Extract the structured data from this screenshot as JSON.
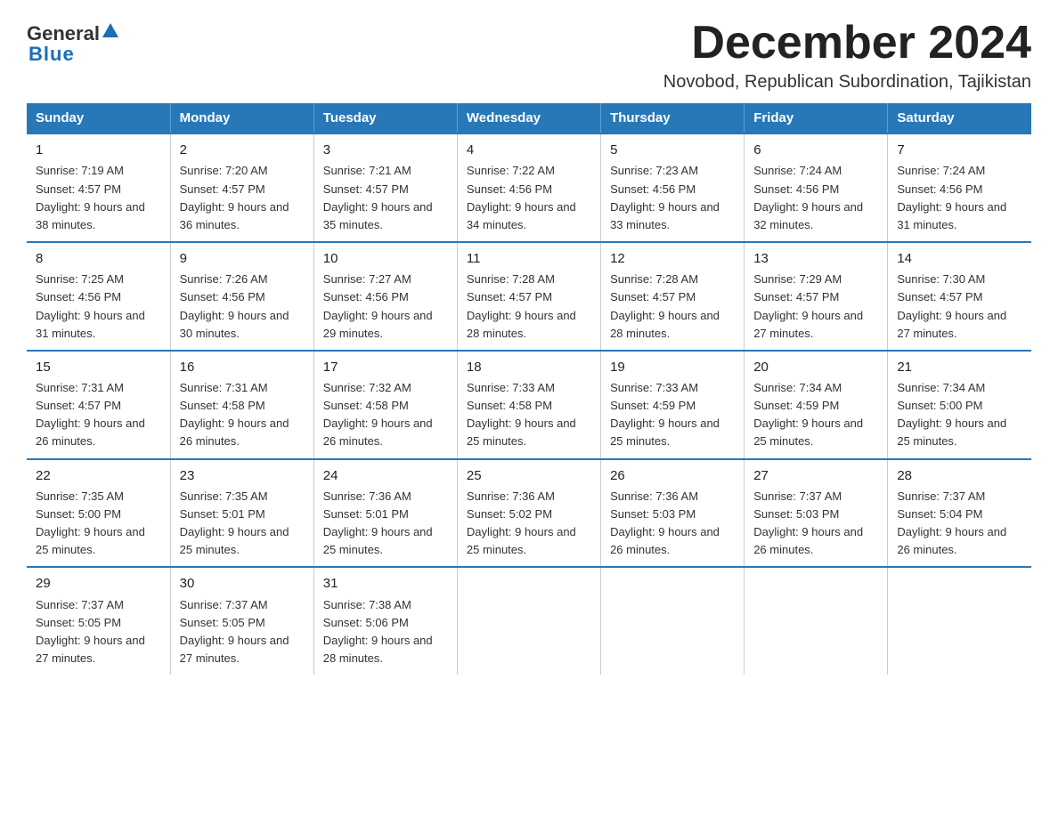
{
  "logo": {
    "general": "General",
    "blue": "Blue"
  },
  "title": "December 2024",
  "subtitle": "Novobod, Republican Subordination, Tajikistan",
  "weekdays": [
    "Sunday",
    "Monday",
    "Tuesday",
    "Wednesday",
    "Thursday",
    "Friday",
    "Saturday"
  ],
  "weeks": [
    [
      {
        "day": "1",
        "sunrise": "7:19 AM",
        "sunset": "4:57 PM",
        "daylight": "9 hours and 38 minutes."
      },
      {
        "day": "2",
        "sunrise": "7:20 AM",
        "sunset": "4:57 PM",
        "daylight": "9 hours and 36 minutes."
      },
      {
        "day": "3",
        "sunrise": "7:21 AM",
        "sunset": "4:57 PM",
        "daylight": "9 hours and 35 minutes."
      },
      {
        "day": "4",
        "sunrise": "7:22 AM",
        "sunset": "4:56 PM",
        "daylight": "9 hours and 34 minutes."
      },
      {
        "day": "5",
        "sunrise": "7:23 AM",
        "sunset": "4:56 PM",
        "daylight": "9 hours and 33 minutes."
      },
      {
        "day": "6",
        "sunrise": "7:24 AM",
        "sunset": "4:56 PM",
        "daylight": "9 hours and 32 minutes."
      },
      {
        "day": "7",
        "sunrise": "7:24 AM",
        "sunset": "4:56 PM",
        "daylight": "9 hours and 31 minutes."
      }
    ],
    [
      {
        "day": "8",
        "sunrise": "7:25 AM",
        "sunset": "4:56 PM",
        "daylight": "9 hours and 31 minutes."
      },
      {
        "day": "9",
        "sunrise": "7:26 AM",
        "sunset": "4:56 PM",
        "daylight": "9 hours and 30 minutes."
      },
      {
        "day": "10",
        "sunrise": "7:27 AM",
        "sunset": "4:56 PM",
        "daylight": "9 hours and 29 minutes."
      },
      {
        "day": "11",
        "sunrise": "7:28 AM",
        "sunset": "4:57 PM",
        "daylight": "9 hours and 28 minutes."
      },
      {
        "day": "12",
        "sunrise": "7:28 AM",
        "sunset": "4:57 PM",
        "daylight": "9 hours and 28 minutes."
      },
      {
        "day": "13",
        "sunrise": "7:29 AM",
        "sunset": "4:57 PM",
        "daylight": "9 hours and 27 minutes."
      },
      {
        "day": "14",
        "sunrise": "7:30 AM",
        "sunset": "4:57 PM",
        "daylight": "9 hours and 27 minutes."
      }
    ],
    [
      {
        "day": "15",
        "sunrise": "7:31 AM",
        "sunset": "4:57 PM",
        "daylight": "9 hours and 26 minutes."
      },
      {
        "day": "16",
        "sunrise": "7:31 AM",
        "sunset": "4:58 PM",
        "daylight": "9 hours and 26 minutes."
      },
      {
        "day": "17",
        "sunrise": "7:32 AM",
        "sunset": "4:58 PM",
        "daylight": "9 hours and 26 minutes."
      },
      {
        "day": "18",
        "sunrise": "7:33 AM",
        "sunset": "4:58 PM",
        "daylight": "9 hours and 25 minutes."
      },
      {
        "day": "19",
        "sunrise": "7:33 AM",
        "sunset": "4:59 PM",
        "daylight": "9 hours and 25 minutes."
      },
      {
        "day": "20",
        "sunrise": "7:34 AM",
        "sunset": "4:59 PM",
        "daylight": "9 hours and 25 minutes."
      },
      {
        "day": "21",
        "sunrise": "7:34 AM",
        "sunset": "5:00 PM",
        "daylight": "9 hours and 25 minutes."
      }
    ],
    [
      {
        "day": "22",
        "sunrise": "7:35 AM",
        "sunset": "5:00 PM",
        "daylight": "9 hours and 25 minutes."
      },
      {
        "day": "23",
        "sunrise": "7:35 AM",
        "sunset": "5:01 PM",
        "daylight": "9 hours and 25 minutes."
      },
      {
        "day": "24",
        "sunrise": "7:36 AM",
        "sunset": "5:01 PM",
        "daylight": "9 hours and 25 minutes."
      },
      {
        "day": "25",
        "sunrise": "7:36 AM",
        "sunset": "5:02 PM",
        "daylight": "9 hours and 25 minutes."
      },
      {
        "day": "26",
        "sunrise": "7:36 AM",
        "sunset": "5:03 PM",
        "daylight": "9 hours and 26 minutes."
      },
      {
        "day": "27",
        "sunrise": "7:37 AM",
        "sunset": "5:03 PM",
        "daylight": "9 hours and 26 minutes."
      },
      {
        "day": "28",
        "sunrise": "7:37 AM",
        "sunset": "5:04 PM",
        "daylight": "9 hours and 26 minutes."
      }
    ],
    [
      {
        "day": "29",
        "sunrise": "7:37 AM",
        "sunset": "5:05 PM",
        "daylight": "9 hours and 27 minutes."
      },
      {
        "day": "30",
        "sunrise": "7:37 AM",
        "sunset": "5:05 PM",
        "daylight": "9 hours and 27 minutes."
      },
      {
        "day": "31",
        "sunrise": "7:38 AM",
        "sunset": "5:06 PM",
        "daylight": "9 hours and 28 minutes."
      },
      null,
      null,
      null,
      null
    ]
  ],
  "labels": {
    "sunrise": "Sunrise:",
    "sunset": "Sunset:",
    "daylight": "Daylight:"
  }
}
